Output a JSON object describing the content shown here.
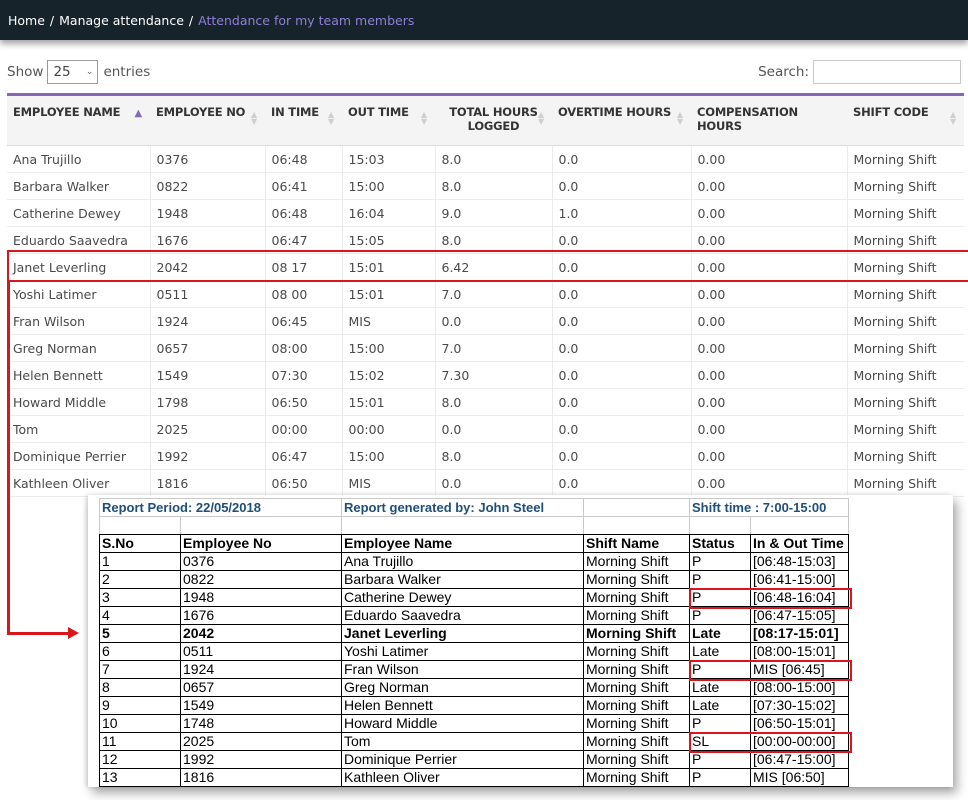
{
  "breadcrumb": {
    "items": [
      "Home",
      "Manage attendance",
      "Attendance for my team members"
    ],
    "separator": "/"
  },
  "controls": {
    "show_label": "Show",
    "entries_label": "entries",
    "page_length": "25",
    "search_label": "Search:",
    "search_value": ""
  },
  "colors": {
    "accent": "#8666b6",
    "topbar": "#16232b",
    "annotation": "#d9161c",
    "report_meta": "#1f4e79"
  },
  "table": {
    "columns": [
      {
        "label": "EMPLOYEE NAME",
        "sort": "asc"
      },
      {
        "label": "EMPLOYEE NO",
        "sort": "none"
      },
      {
        "label": "IN TIME",
        "sort": "none"
      },
      {
        "label": "OUT TIME",
        "sort": "none"
      },
      {
        "label": "TOTAL HOURS LOGGED",
        "sort": "none"
      },
      {
        "label": "OVERTIME HOURS",
        "sort": "none"
      },
      {
        "label": "COMPENSATION HOURS",
        "sort": "none"
      },
      {
        "label": "SHIFT CODE",
        "sort": "none"
      }
    ],
    "rows": [
      [
        "Ana Trujillo",
        "0376",
        "06:48",
        "15:03",
        "8.0",
        "0.0",
        "0.00",
        "Morning Shift"
      ],
      [
        "Barbara Walker",
        "0822",
        "06:41",
        "15:00",
        "8.0",
        "0.0",
        "0.00",
        "Morning Shift"
      ],
      [
        "Catherine Dewey",
        "1948",
        "06:48",
        "16:04",
        "9.0",
        "1.0",
        "0.00",
        "Morning Shift"
      ],
      [
        "Eduardo Saavedra",
        "1676",
        "06:47",
        "15:05",
        "8.0",
        "0.0",
        "0.00",
        "Morning Shift"
      ],
      [
        "Janet Leverling",
        "2042",
        "08 17",
        "15:01",
        "6.42",
        "0.0",
        "0.00",
        "Morning Shift"
      ],
      [
        "Yoshi Latimer",
        "0511",
        "08 00",
        "15:01",
        "7.0",
        "0.0",
        "0.00",
        "Morning Shift"
      ],
      [
        "Fran Wilson",
        "1924",
        "06:45",
        "MIS",
        "0.0",
        "0.0",
        "0.00",
        "Morning Shift"
      ],
      [
        "Greg Norman",
        "0657",
        "08:00",
        "15:00",
        "7.0",
        "0.0",
        "0.00",
        "Morning Shift"
      ],
      [
        "Helen Bennett",
        "1549",
        "07:30",
        "15:02",
        "7.30",
        "0.0",
        "0.00",
        "Morning Shift"
      ],
      [
        "Howard Middle",
        "1798",
        "06:50",
        "15:01",
        "8.0",
        "0.0",
        "0.00",
        "Morning Shift"
      ],
      [
        "Tom",
        "2025",
        "00:00",
        "00:00",
        "0.0",
        "0.0",
        "0.00",
        "Morning Shift"
      ],
      [
        "Dominique Perrier",
        "1992",
        "06:47",
        "15:00",
        "8.0",
        "0.0",
        "0.00",
        "Morning Shift"
      ],
      [
        "Kathleen Oliver",
        "1816",
        "06:50",
        "MIS",
        "0.0",
        "0.0",
        "0.00",
        "Morning Shift"
      ]
    ],
    "highlighted_row": 4
  },
  "report": {
    "period": "Report Period: 22/05/2018",
    "generated_by": "Report generated by: John  Steel",
    "shift_time": "Shift time : 7:00-15:00",
    "columns": [
      "S.No",
      "Employee No",
      "Employee Name",
      "Shift Name",
      "Status",
      "In & Out Time"
    ],
    "rows": [
      [
        "1",
        "0376",
        "Ana Trujillo",
        "Morning Shift",
        "P",
        "[06:48-15:03]"
      ],
      [
        "2",
        "0822",
        "Barbara Walker",
        "Morning Shift",
        "P",
        "[06:41-15:00]"
      ],
      [
        "3",
        "1948",
        "Catherine Dewey",
        "Morning Shift",
        "P",
        "[06:48-16:04]"
      ],
      [
        "4",
        "1676",
        "Eduardo Saavedra",
        "Morning Shift",
        "P",
        "[06:47-15:05]"
      ],
      [
        "5",
        "2042",
        "Janet Leverling",
        "Morning Shift",
        "Late",
        "[08:17-15:01]"
      ],
      [
        "6",
        "0511",
        "Yoshi Latimer",
        "Morning Shift",
        "Late",
        "[08:00-15:01]"
      ],
      [
        "7",
        "1924",
        "Fran Wilson",
        "Morning Shift",
        "P",
        "MIS [06:45]"
      ],
      [
        "8",
        "0657",
        "Greg Norman",
        "Morning Shift",
        "Late",
        "[08:00-15:00]"
      ],
      [
        "9",
        "1549",
        "Helen Bennett",
        "Morning Shift",
        "Late",
        "[07:30-15:02]"
      ],
      [
        "10",
        "1748",
        "Howard Middle",
        "Morning Shift",
        "P",
        "[06:50-15:01]"
      ],
      [
        "11",
        "2025",
        "Tom",
        "Morning Shift",
        "SL",
        "[00:00-00:00]"
      ],
      [
        "12",
        "1992",
        "Dominique Perrier",
        "Morning Shift",
        "P",
        "[06:47-15:00]"
      ],
      [
        "13",
        "1816",
        "Kathleen Oliver",
        "Morning Shift",
        "P",
        "MIS [06:50]"
      ]
    ],
    "bold_row": 4,
    "boxed_rows": [
      2,
      6,
      10
    ]
  }
}
